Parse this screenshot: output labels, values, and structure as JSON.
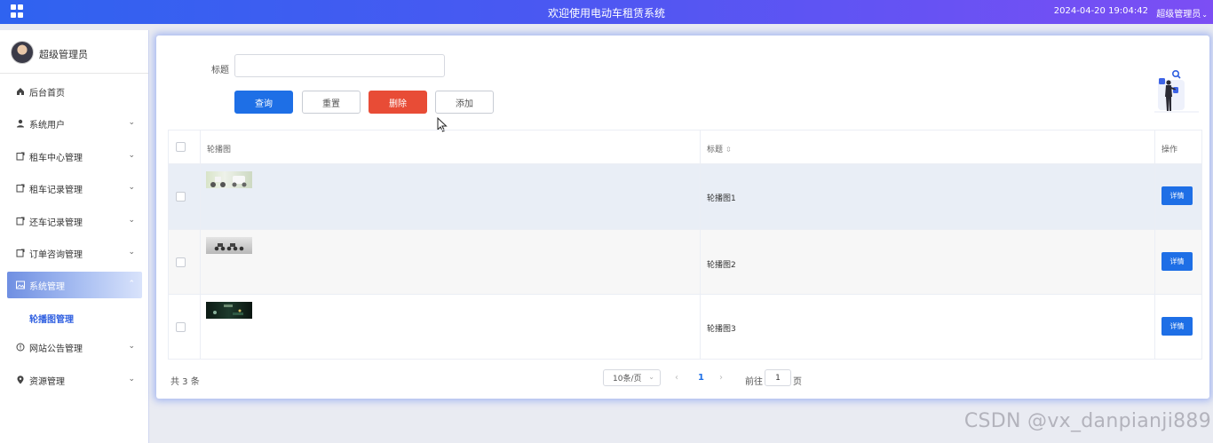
{
  "header": {
    "title": "欢迎使用电动车租赁系统",
    "datetime": "2024-04-20 19:04:42",
    "user_menu": "超级管理员"
  },
  "sidebar": {
    "profile_name": "超级管理员",
    "items": [
      {
        "label": "后台首页",
        "icon": "home-icon"
      },
      {
        "label": "系统用户",
        "icon": "user-icon"
      },
      {
        "label": "租车中心管理",
        "icon": "document-icon"
      },
      {
        "label": "租车记录管理",
        "icon": "document-icon"
      },
      {
        "label": "还车记录管理",
        "icon": "document-icon"
      },
      {
        "label": "订单咨询管理",
        "icon": "document-icon"
      },
      {
        "label": "系统管理",
        "icon": "picture-icon"
      },
      {
        "label": "网站公告管理",
        "icon": "info-icon"
      },
      {
        "label": "资源管理",
        "icon": "location-icon"
      }
    ],
    "active_item": "系统管理",
    "active_submenu": "轮播图管理"
  },
  "search": {
    "label": "标题",
    "value": "",
    "placeholder": ""
  },
  "toolbar": {
    "query": "查询",
    "reset": "重置",
    "delete": "删除",
    "add": "添加"
  },
  "table": {
    "columns": [
      "轮播图",
      "标题",
      "操作"
    ],
    "rows": [
      {
        "title": "轮播图1",
        "action": "详情"
      },
      {
        "title": "轮播图2",
        "action": "详情"
      },
      {
        "title": "轮播图3",
        "action": "详情"
      }
    ]
  },
  "pagination": {
    "total": "共 3 条",
    "page_size": "10条/页",
    "prev": "‹",
    "current": "1",
    "next": "›",
    "goto_label": "前往",
    "goto_value": "1",
    "goto_unit": "页"
  },
  "watermark": "CSDN @vx_danpianji889",
  "colors": {
    "topbar_start": "#2f63f0",
    "topbar_end": "#7c4ef4",
    "primary": "#1e6fe6",
    "danger": "#e84c36"
  }
}
